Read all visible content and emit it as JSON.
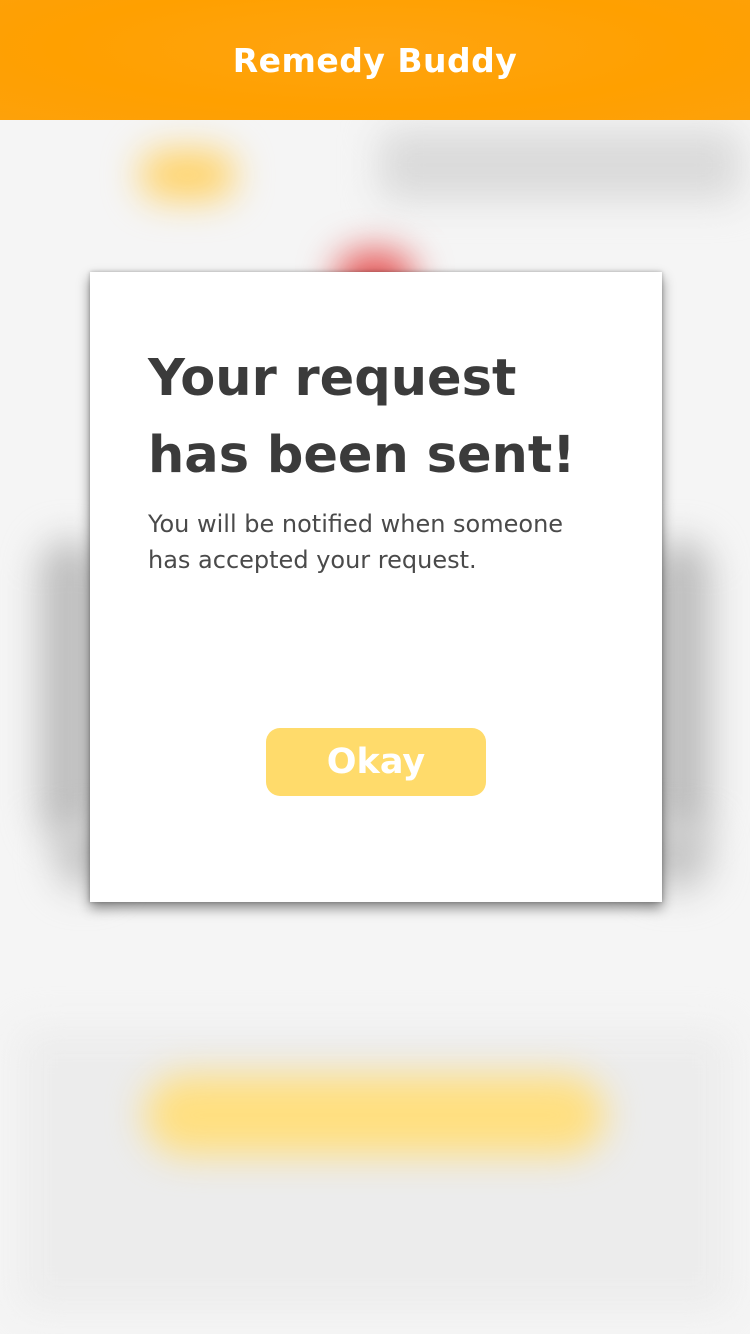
{
  "app": {
    "title": "Remedy Buddy"
  },
  "dialog": {
    "title": "Your request has been sent!",
    "message": "You will be notified when someone has accepted your request.",
    "ok_label": "Okay"
  },
  "colors": {
    "nav_bar": "#ffa000",
    "button": "#ffdb6b",
    "dialog_background": "#ffffff",
    "title_text": "#3b3b3b"
  }
}
